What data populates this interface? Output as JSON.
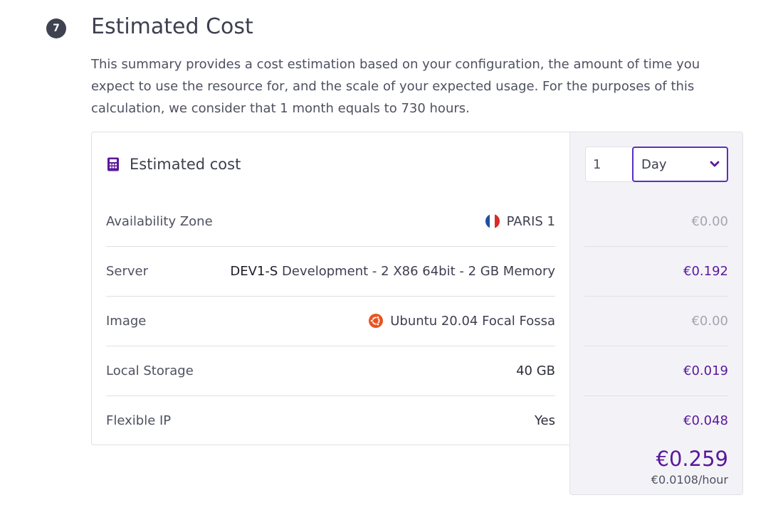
{
  "section": {
    "step": "7",
    "title": "Estimated Cost",
    "description": "This summary provides a cost estimation based on your configuration, the amount of time you expect to use the resource for, and the scale of your expected usage. For the purposes of this calculation, we consider that 1 month equals to 730 hours."
  },
  "card": {
    "title": "Estimated cost",
    "icon": "calculator-icon"
  },
  "controls": {
    "quantity": "1",
    "period": "Day"
  },
  "rows": [
    {
      "label": "Availability Zone",
      "value": "PARIS 1",
      "icon": "france-flag-icon",
      "price": "€0.00"
    },
    {
      "label": "Server",
      "value_bold": "DEV1-S",
      "value": "Development - 2 X86 64bit - 2 GB Memory",
      "price": "€0.192"
    },
    {
      "label": "Image",
      "value": "Ubuntu 20.04 Focal Fossa",
      "icon": "ubuntu-icon",
      "price": "€0.00"
    },
    {
      "label": "Local Storage",
      "value": "40 GB",
      "price": "€0.019"
    },
    {
      "label": "Flexible IP",
      "value": "Yes",
      "price": "€0.048"
    }
  ],
  "total": {
    "amount": "€0.259",
    "per_hour": "€0.0108/hour"
  },
  "colors": {
    "accent": "#5a189a",
    "select_border": "#5a2fc2",
    "badge": "#3f4250",
    "muted_price": "#a3a5b0"
  }
}
